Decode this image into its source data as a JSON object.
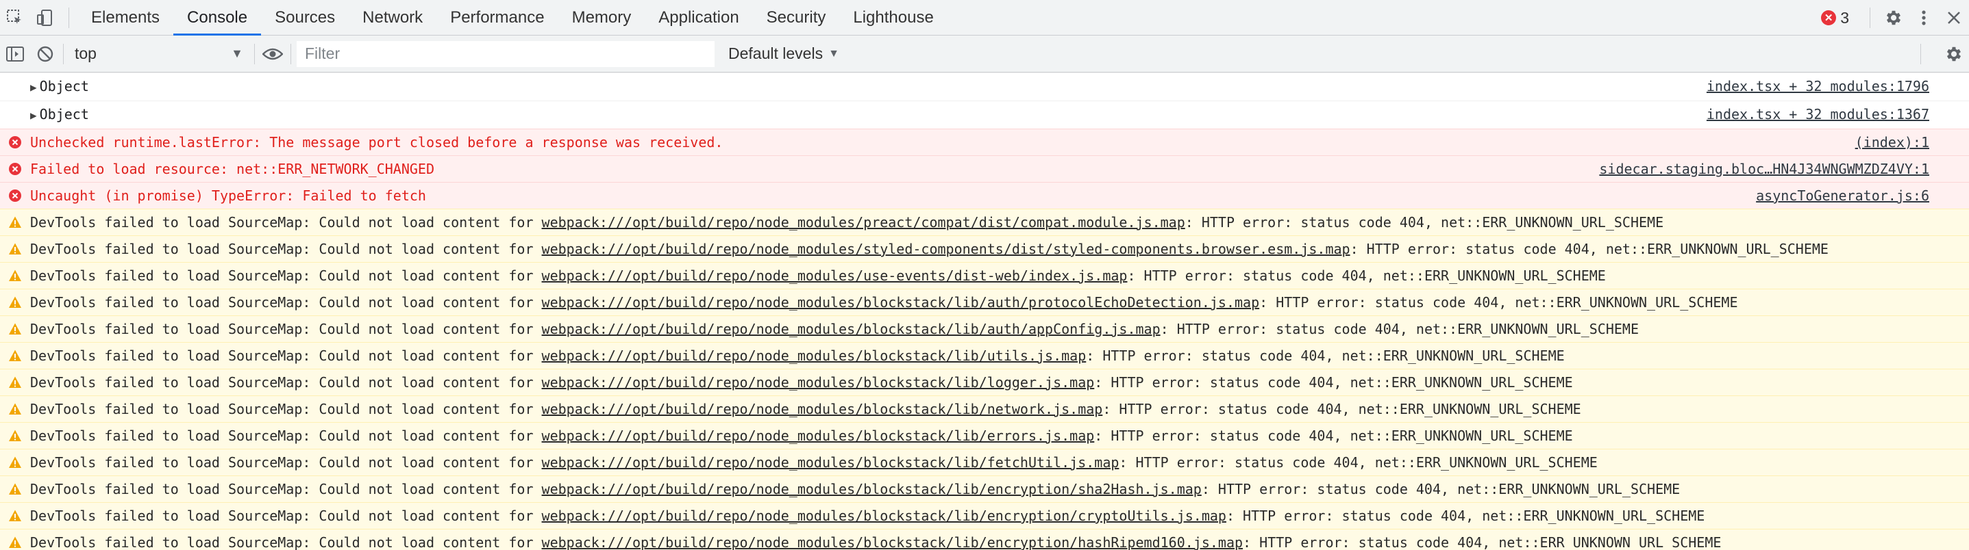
{
  "tabs": [
    "Elements",
    "Console",
    "Sources",
    "Network",
    "Performance",
    "Memory",
    "Application",
    "Security",
    "Lighthouse"
  ],
  "active_tab": "Console",
  "error_count": "3",
  "toolbar": {
    "context": "top",
    "filter_placeholder": "Filter",
    "levels_label": "Default levels"
  },
  "messages": [
    {
      "type": "log",
      "text": "Object",
      "source": "index.tsx + 32 modules:1796"
    },
    {
      "type": "log",
      "text": "Object",
      "source": "index.tsx + 32 modules:1367"
    },
    {
      "type": "error",
      "text": "Unchecked runtime.lastError: The message port closed before a response was received.",
      "source": "(index):1"
    },
    {
      "type": "error",
      "text": "Failed to load resource: net::ERR_NETWORK_CHANGED",
      "source": "sidecar.staging.bloc…HN4J34WNGWMZDZ4VY:1"
    },
    {
      "type": "error",
      "text": "Uncaught (in promise) TypeError: Failed to fetch",
      "source": "asyncToGenerator.js:6"
    },
    {
      "type": "warning",
      "prefix": "DevTools failed to load SourceMap: Could not load content for ",
      "link": "webpack:///opt/build/repo/node_modules/preact/compat/dist/compat.module.js.map",
      "suffix": ": HTTP error: status code 404, net::ERR_UNKNOWN_URL_SCHEME"
    },
    {
      "type": "warning",
      "prefix": "DevTools failed to load SourceMap: Could not load content for ",
      "link": "webpack:///opt/build/repo/node_modules/styled-components/dist/styled-components.browser.esm.js.map",
      "suffix": ": HTTP error: status code 404, net::ERR_UNKNOWN_URL_SCHEME"
    },
    {
      "type": "warning",
      "prefix": "DevTools failed to load SourceMap: Could not load content for ",
      "link": "webpack:///opt/build/repo/node_modules/use-events/dist-web/index.js.map",
      "suffix": ": HTTP error: status code 404, net::ERR_UNKNOWN_URL_SCHEME"
    },
    {
      "type": "warning",
      "prefix": "DevTools failed to load SourceMap: Could not load content for ",
      "link": "webpack:///opt/build/repo/node_modules/blockstack/lib/auth/protocolEchoDetection.js.map",
      "suffix": ": HTTP error: status code 404, net::ERR_UNKNOWN_URL_SCHEME"
    },
    {
      "type": "warning",
      "prefix": "DevTools failed to load SourceMap: Could not load content for ",
      "link": "webpack:///opt/build/repo/node_modules/blockstack/lib/auth/appConfig.js.map",
      "suffix": ": HTTP error: status code 404, net::ERR_UNKNOWN_URL_SCHEME"
    },
    {
      "type": "warning",
      "prefix": "DevTools failed to load SourceMap: Could not load content for ",
      "link": "webpack:///opt/build/repo/node_modules/blockstack/lib/utils.js.map",
      "suffix": ": HTTP error: status code 404, net::ERR_UNKNOWN_URL_SCHEME"
    },
    {
      "type": "warning",
      "prefix": "DevTools failed to load SourceMap: Could not load content for ",
      "link": "webpack:///opt/build/repo/node_modules/blockstack/lib/logger.js.map",
      "suffix": ": HTTP error: status code 404, net::ERR_UNKNOWN_URL_SCHEME"
    },
    {
      "type": "warning",
      "prefix": "DevTools failed to load SourceMap: Could not load content for ",
      "link": "webpack:///opt/build/repo/node_modules/blockstack/lib/network.js.map",
      "suffix": ": HTTP error: status code 404, net::ERR_UNKNOWN_URL_SCHEME"
    },
    {
      "type": "warning",
      "prefix": "DevTools failed to load SourceMap: Could not load content for ",
      "link": "webpack:///opt/build/repo/node_modules/blockstack/lib/errors.js.map",
      "suffix": ": HTTP error: status code 404, net::ERR_UNKNOWN_URL_SCHEME"
    },
    {
      "type": "warning",
      "prefix": "DevTools failed to load SourceMap: Could not load content for ",
      "link": "webpack:///opt/build/repo/node_modules/blockstack/lib/fetchUtil.js.map",
      "suffix": ": HTTP error: status code 404, net::ERR_UNKNOWN_URL_SCHEME"
    },
    {
      "type": "warning",
      "prefix": "DevTools failed to load SourceMap: Could not load content for ",
      "link": "webpack:///opt/build/repo/node_modules/blockstack/lib/encryption/sha2Hash.js.map",
      "suffix": ": HTTP error: status code 404, net::ERR_UNKNOWN_URL_SCHEME"
    },
    {
      "type": "warning",
      "prefix": "DevTools failed to load SourceMap: Could not load content for ",
      "link": "webpack:///opt/build/repo/node_modules/blockstack/lib/encryption/cryptoUtils.js.map",
      "suffix": ": HTTP error: status code 404, net::ERR_UNKNOWN_URL_SCHEME"
    },
    {
      "type": "warning",
      "prefix": "DevTools failed to load SourceMap: Could not load content for ",
      "link": "webpack:///opt/build/repo/node_modules/blockstack/lib/encryption/hashRipemd160.js.map",
      "suffix": ": HTTP error: status code 404, net::ERR_UNKNOWN_URL_SCHEME"
    }
  ],
  "colors": {
    "accent": "#1a73e8",
    "error_bg": "#fff0f0",
    "error_text": "#e0201c",
    "warning_bg": "#fffbe5",
    "warning_icon": "#f2a600"
  }
}
